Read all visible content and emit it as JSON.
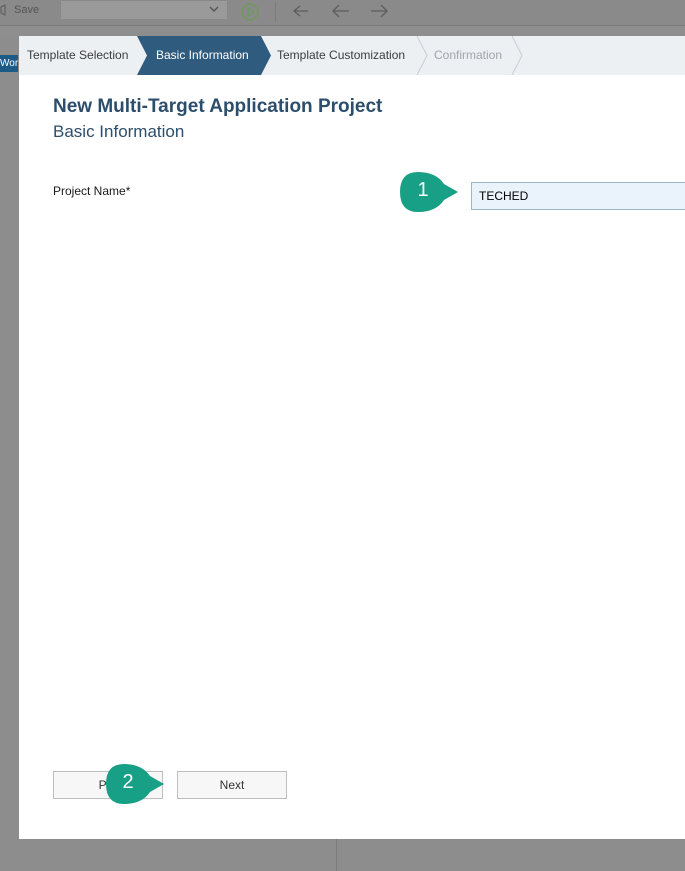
{
  "ide": {
    "save_label": "Save",
    "left_tab_label": "Wor"
  },
  "wizard": {
    "steps": [
      {
        "label": "Template Selection",
        "state": "done"
      },
      {
        "label": "Basic Information",
        "state": "active"
      },
      {
        "label": "Template Customization",
        "state": "upcoming"
      },
      {
        "label": "Confirmation",
        "state": "disabled"
      }
    ]
  },
  "dialog": {
    "title": "New Multi-Target Application Project",
    "subtitle": "Basic Information",
    "project_name_label": "Project Name*",
    "project_name_value": "TECHED"
  },
  "buttons": {
    "previous_label": "Pre",
    "next_label": "Next"
  },
  "callouts": {
    "first": "1",
    "second": "2"
  },
  "colors": {
    "wizard_active": "#2f5b7e",
    "callout": "#17a085",
    "title": "#2c4e6c",
    "input_bg": "#eaf3fb"
  }
}
